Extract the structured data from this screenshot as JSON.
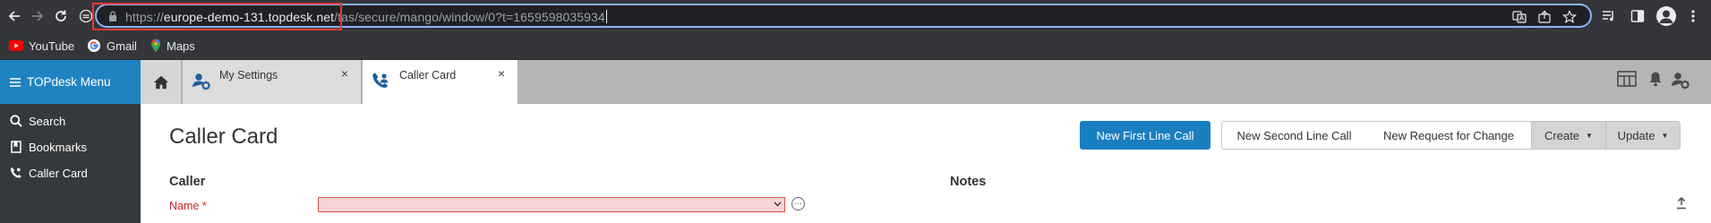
{
  "browser": {
    "url_scheme": "https://",
    "url_domain": "europe-demo-131.topdesk.net",
    "url_path": "/tas/secure/mango/window/0?t=1659598035934",
    "bookmarks": [
      {
        "label": "YouTube",
        "icon": "youtube-icon"
      },
      {
        "label": "Gmail",
        "icon": "google-icon"
      },
      {
        "label": "Maps",
        "icon": "maps-pin-icon"
      }
    ]
  },
  "app": {
    "menu_label": "TOPdesk Menu",
    "tabs": [
      {
        "label": "My Settings",
        "close": "×",
        "active": false
      },
      {
        "label": "Caller Card",
        "close": "×",
        "active": true
      }
    ],
    "sidebar": [
      {
        "label": "Search",
        "icon": "search-icon"
      },
      {
        "label": "Bookmarks",
        "icon": "bookmark-icon"
      },
      {
        "label": "Caller Card",
        "icon": "caller-icon"
      }
    ]
  },
  "page": {
    "title": "Caller Card",
    "buttons": {
      "new_first_line": "New First Line Call",
      "new_second_line": "New Second Line Call",
      "new_rfc": "New Request for Change",
      "create": "Create",
      "update": "Update"
    },
    "caller_section": "Caller",
    "notes_section": "Notes",
    "name_label": "Name *",
    "name_value": "",
    "more_glyph": "···"
  },
  "colors": {
    "brand_blue": "#1f83c2",
    "primary_button": "#1a7fc1",
    "required_red": "#c62828",
    "highlight_red": "#e53935"
  }
}
